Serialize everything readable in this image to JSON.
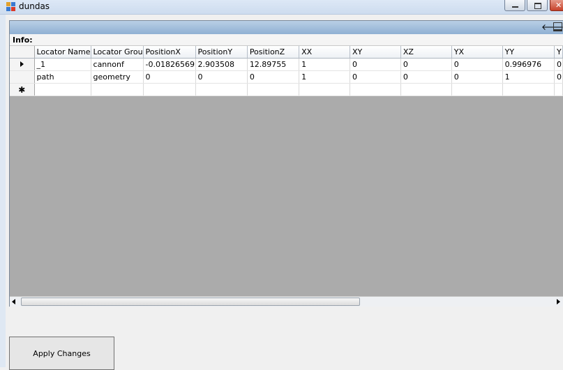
{
  "window": {
    "title": "dundas"
  },
  "infobar": {
    "label": "Info:"
  },
  "grid": {
    "columns": [
      "Locator Name",
      "Locator Grou",
      "PositionX",
      "PositionY",
      "PositionZ",
      "XX",
      "XY",
      "XZ",
      "YX",
      "YY",
      "Y"
    ],
    "rows": [
      [
        "_1",
        "cannonf",
        "-0.01826569",
        "2.903508",
        "12.89755",
        "1",
        "0",
        "0",
        "0",
        "0.996976",
        "0"
      ],
      [
        "path",
        "geometry",
        "0",
        "0",
        "0",
        "1",
        "0",
        "0",
        "0",
        "1",
        "0"
      ]
    ],
    "new_row_marker": "✱"
  },
  "toolbar": {
    "icons": [
      "arrow-left-icon",
      "panel-dropdown-icon"
    ]
  },
  "apply_button": {
    "label": "Apply Changes"
  }
}
